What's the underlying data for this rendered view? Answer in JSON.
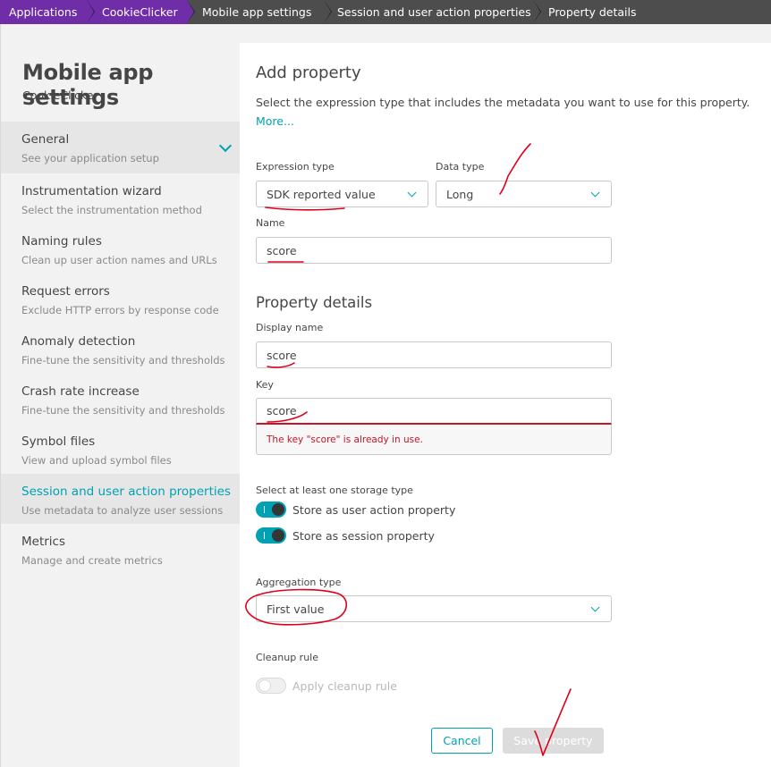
{
  "breadcrumb": [
    "Applications",
    "CookieClicker",
    "Mobile app settings",
    "Session and user action properties",
    "Property details"
  ],
  "sidebar": {
    "title": "Mobile app settings",
    "subtitle": "CookieClicker",
    "items": [
      {
        "label": "General",
        "desc": "See your application setup"
      },
      {
        "label": "Instrumentation wizard",
        "desc": "Select the instrumentation method"
      },
      {
        "label": "Naming rules",
        "desc": "Clean up user action names and URLs"
      },
      {
        "label": "Request errors",
        "desc": "Exclude HTTP errors by response code"
      },
      {
        "label": "Anomaly detection",
        "desc": "Fine-tune the sensitivity and thresholds"
      },
      {
        "label": "Crash rate increase",
        "desc": "Fine-tune the sensitivity and thresholds"
      },
      {
        "label": "Symbol files",
        "desc": "View and upload symbol files"
      },
      {
        "label": "Session and user action properties",
        "desc": "Use metadata to analyze user sessions"
      },
      {
        "label": "Metrics",
        "desc": "Manage and create metrics"
      }
    ]
  },
  "form": {
    "heading": "Add property",
    "intro": "Select the expression type that includes the metadata you want to use for this property.",
    "more_link": "More...",
    "expression_type_label": "Expression type",
    "expression_type_value": "SDK reported value",
    "data_type_label": "Data type",
    "data_type_value": "Long",
    "name_label": "Name",
    "name_value": "score",
    "details_heading": "Property details",
    "display_name_label": "Display name",
    "display_name_value": "score",
    "key_label": "Key",
    "key_value": "score",
    "key_error": "The key \"score\" is already in use.",
    "storage_label": "Select at least one storage type",
    "store_user_action": "Store as user action property",
    "store_session": "Store as session property",
    "aggregation_label": "Aggregation type",
    "aggregation_value": "First value",
    "cleanup_label": "Cleanup rule",
    "cleanup_toggle_label": "Apply cleanup rule",
    "cancel_button": "Cancel",
    "save_button": "Save property"
  },
  "colors": {
    "accent": "#00a1b2",
    "breadcrumb_purple": "#6f2da8",
    "error": "#c41425",
    "annotation": "#e0001a"
  }
}
